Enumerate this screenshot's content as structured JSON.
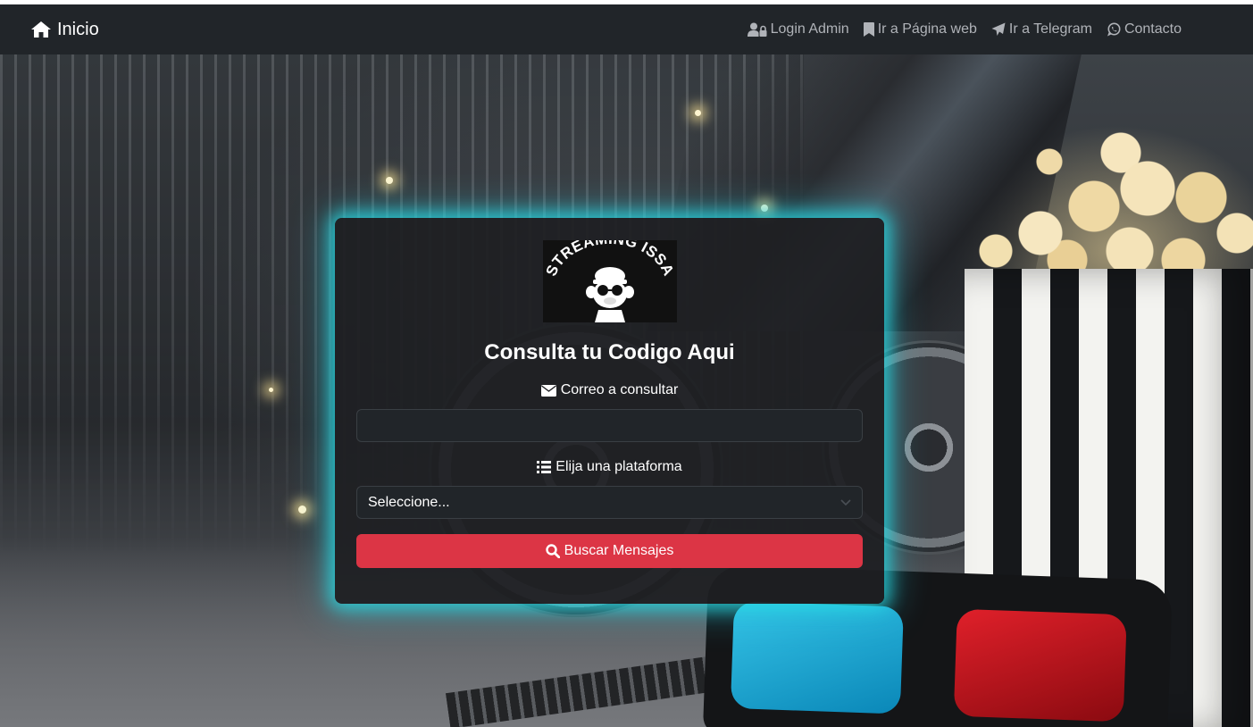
{
  "navbar": {
    "brand_label": "Inicio",
    "links": [
      {
        "label": "Login Admin",
        "icon": "user-lock-icon"
      },
      {
        "label": "Ir a Página web",
        "icon": "bookmark-icon"
      },
      {
        "label": "Ir a Telegram",
        "icon": "paper-plane-icon"
      },
      {
        "label": "Contacto",
        "icon": "whatsapp-icon"
      }
    ]
  },
  "card": {
    "logo_text": "STREAMING ISSA",
    "title": "Consulta tu Codigo Aqui",
    "email_label": "Correo a consultar",
    "email_value": "",
    "platform_label": "Elija una plataforma",
    "platform_selected": "Seleccione...",
    "search_button_label": "Buscar Mensajes"
  },
  "colors": {
    "navbar_bg": "#212529",
    "card_glow": "#28dce6",
    "button_red": "#dc3545"
  }
}
